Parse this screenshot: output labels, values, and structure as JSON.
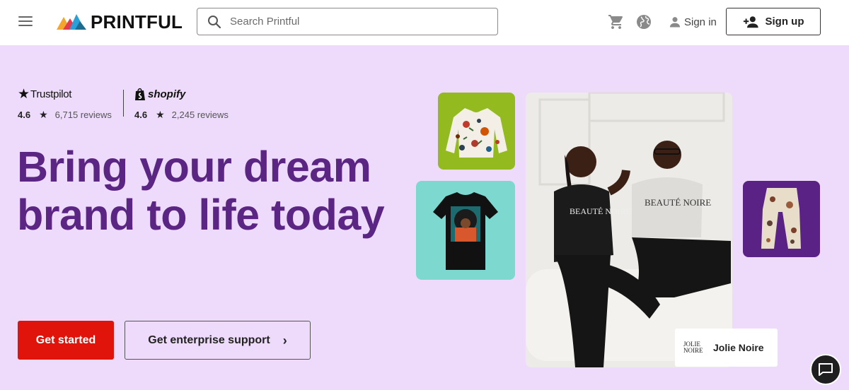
{
  "header": {
    "menu_icon": "hamburger-menu-icon",
    "logo_text": "PRINTFUL",
    "search": {
      "placeholder": "Search Printful",
      "value": ""
    },
    "cart_icon": "cart-icon",
    "language_icon": "globe-icon",
    "signin_label": "Sign in",
    "signup_label": "Sign up"
  },
  "hero": {
    "trustpilot": {
      "brand": "Trustpilot",
      "score": "4.6",
      "reviews": "6,715 reviews"
    },
    "shopify": {
      "brand": "shopify",
      "score": "4.6",
      "reviews": "2,245 reviews"
    },
    "headline": "Bring your dream brand to life today",
    "primary_cta": "Get started",
    "secondary_cta": "Get enterprise support",
    "brand_card": {
      "logo_text": "JOLIE NOIRE",
      "name": "Jolie Noire"
    },
    "tshirt_text": "BEAUTÉ NOIRE",
    "colors": {
      "accent": "#5a2583",
      "hero_bg": "#eedbfb",
      "cta_red": "#e0140b",
      "tile_green": "#93bb1f",
      "tile_teal": "#7dd8d0",
      "tile_purple": "#5b2286"
    }
  },
  "chat_icon": "chat-icon"
}
